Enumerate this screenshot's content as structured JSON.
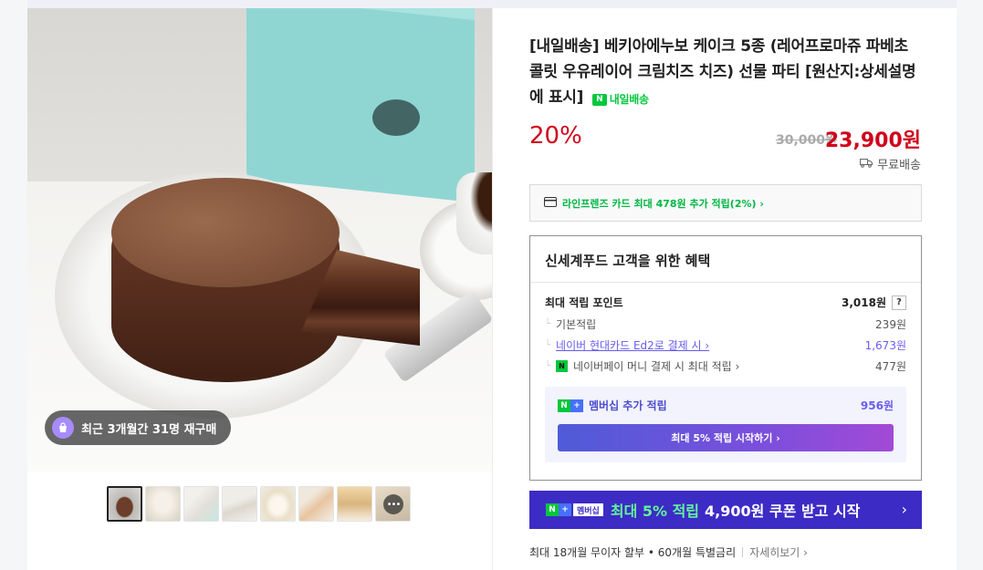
{
  "gallery": {
    "badge_text": "최근 3개월간 31명 재구매",
    "thumbnails": [
      "cake-slice",
      "cheesecake-plate",
      "gift-box",
      "cake-set",
      "rare-cheesecake",
      "cake-variety",
      "cake-lineup",
      "more"
    ],
    "more_label": "•••"
  },
  "product": {
    "title": "[내일배송] 베키아에누보 케이크 5종 (레어프로마쥬 파베초콜릿 우유레이어 크림치즈 치즈) 선물 파티 [원산지:상세설명에 표시]",
    "delivery_badge": "N",
    "delivery_label": "내일배송",
    "discount": "20%",
    "original_price": "30,000원",
    "sale_price": "23,900원",
    "shipping": "무료배송"
  },
  "card_promo": {
    "label": "라인프렌즈 카드 최대 478원 추가 적립(2%) ›"
  },
  "benefit": {
    "title": "신세계푸드 고객을 위한 혜택",
    "max_points_label": "최대 적립 포인트",
    "max_points_value": "3,018원",
    "help": "?",
    "tree": "└",
    "basic_label": "기본적립",
    "basic_value": "239원",
    "card_label": "네이버 현대카드 Ed2로 결제 시 ›",
    "card_value": "1,673원",
    "pay_icon": "N",
    "pay_label": "네이버페이 머니 결제 시 최대 적립 ›",
    "pay_value": "477원",
    "member_n": "N",
    "member_plus": "+",
    "member_label": "멤버십 추가 적립",
    "member_value": "956원",
    "member_button": "최대 5% 적립 시작하기 ›"
  },
  "coupon_banner": {
    "badge_n": "N",
    "badge_plus": "+",
    "badge_member": "멤버십",
    "green_text": "최대 5% 적립",
    "white_text": "4,900원 쿠폰 받고 시작",
    "arrow": "›"
  },
  "installment": {
    "text": "최대 18개월 무이자 할부 • 60개월 특별금리",
    "more": "자세히보기 ›"
  }
}
